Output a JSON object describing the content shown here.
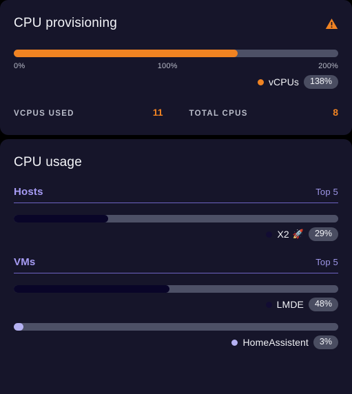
{
  "provisioning": {
    "title": "CPU provisioning",
    "warning_icon": "warning-triangle-icon",
    "warning_color": "#f08322",
    "bar": {
      "value_pct": 138,
      "max_pct": 200,
      "fill_color": "#f08322",
      "track_color": "#4d5066"
    },
    "axis": {
      "min": "0%",
      "mid": "100%",
      "max": "200%"
    },
    "legend": {
      "dot_color": "#f08322",
      "label": "vCPUs",
      "badge": "138%"
    },
    "stats": [
      {
        "label": "VCPUS USED",
        "value": "11",
        "value_color": "#f08322"
      },
      {
        "label": "TOTAL CPUS",
        "value": "8",
        "value_color": "#f08322"
      }
    ]
  },
  "usage": {
    "title": "CPU usage",
    "sections": [
      {
        "name": "Hosts",
        "top": "Top 5",
        "entries": [
          {
            "label": "X2",
            "emoji": "🚀",
            "badge": "29%",
            "value_pct": 29,
            "fill_color": "#090528",
            "dot_color": "#120c33"
          }
        ]
      },
      {
        "name": "VMs",
        "top": "Top 5",
        "entries": [
          {
            "label": "LMDE",
            "emoji": "",
            "badge": "48%",
            "value_pct": 48,
            "fill_color": "#090528",
            "dot_color": "#120c33"
          },
          {
            "label": "HomeAssistent",
            "emoji": "",
            "badge": "3%",
            "value_pct": 3,
            "fill_color": "#b5b1f2",
            "dot_color": "#b5b1f2"
          }
        ]
      }
    ]
  },
  "chart_data": {
    "type": "bar",
    "title": "CPU provisioning / CPU usage",
    "charts": [
      {
        "title": "CPU provisioning",
        "type": "bar",
        "orientation": "horizontal",
        "categories": [
          "vCPUs"
        ],
        "values": [
          138
        ],
        "unit": "%",
        "xlim": [
          0,
          200
        ],
        "tick_labels": [
          "0%",
          "100%",
          "200%"
        ],
        "grid": false,
        "legend": "bottom-right",
        "colors": [
          "#f08322"
        ]
      },
      {
        "title": "CPU usage — Hosts (Top 5)",
        "type": "bar",
        "orientation": "horizontal",
        "categories": [
          "X2 🚀"
        ],
        "values": [
          29
        ],
        "unit": "%",
        "xlim": [
          0,
          100
        ],
        "grid": false,
        "legend": "bottom-right",
        "colors": [
          "#090528"
        ]
      },
      {
        "title": "CPU usage — VMs (Top 5)",
        "type": "bar",
        "orientation": "horizontal",
        "categories": [
          "LMDE",
          "HomeAssistent"
        ],
        "values": [
          48,
          3
        ],
        "unit": "%",
        "xlim": [
          0,
          100
        ],
        "grid": false,
        "legend": "bottom-right",
        "colors": [
          "#090528",
          "#b5b1f2"
        ]
      }
    ]
  }
}
